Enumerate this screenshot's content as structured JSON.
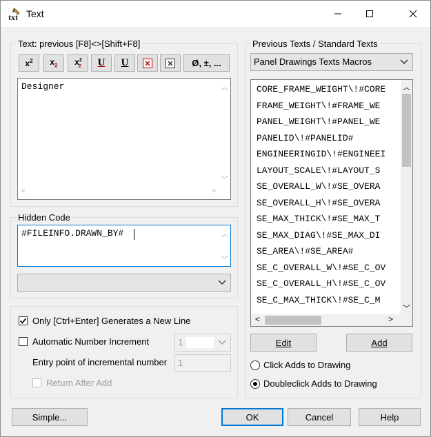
{
  "window": {
    "title": "Text"
  },
  "text_group": {
    "label": "Text: previous [F8]<>[Shift+F8]",
    "format_buttons": [
      {
        "name": "superscript-button",
        "base": "x",
        "sup": "2"
      },
      {
        "name": "subscript-button",
        "base": "x",
        "sub": "2"
      },
      {
        "name": "stacked-fraction-button",
        "base": "x",
        "sup": "2",
        "sub": "2"
      },
      {
        "name": "underline-button",
        "glyph": "U"
      },
      {
        "name": "overline-button",
        "glyph": "U"
      },
      {
        "name": "clear-format-button",
        "glyph": "×"
      },
      {
        "name": "delete-button",
        "glyph": "×"
      },
      {
        "name": "special-chars-button",
        "glyph": "Ø, ±, ..."
      }
    ],
    "text_value": "Designer"
  },
  "hidden_code": {
    "label": "Hidden Code",
    "value": "#FILEINFO.DRAWN_BY#",
    "dropdown_value": ""
  },
  "options": {
    "only_ctrl_enter": {
      "label_pre": "Only [Ctrl+Enter] Generates a New Line",
      "checked": true
    },
    "auto_number": {
      "label": "Automatic Number Increment",
      "value": "1",
      "checked": false
    },
    "entry_point": {
      "label": "Entry point of incremental number",
      "value": "1"
    },
    "return_after_add": {
      "label": "Return After Add",
      "checked": false
    }
  },
  "previous_texts": {
    "label": "Previous Texts / Standard Texts",
    "category": "Panel Drawings Texts Macros",
    "items": [
      "CORE_FRAME_WEIGHT\\!#CORE",
      "FRAME_WEIGHT\\!#FRAME_WE",
      "PANEL_WEIGHT\\!#PANEL_WE",
      "PANELID\\!#PANELID#",
      "ENGINEERINGID\\!#ENGINEEI",
      "LAYOUT_SCALE\\!#LAYOUT_S",
      "SE_OVERALL_W\\!#SE_OVERA",
      "SE_OVERALL_H\\!#SE_OVERA",
      "SE_MAX_THICK\\!#SE_MAX_T",
      "SE_MAX_DIAG\\!#SE_MAX_DI",
      "SE_AREA\\!#SE_AREA#",
      "SE_C_OVERALL_W\\!#SE_C_OV",
      "SE_C_OVERALL_H\\!#SE_C_OV",
      "SE_C_MAX_THICK\\!#SE_C_M"
    ],
    "edit_label": "Edit",
    "add_label": "Add",
    "click_adds": "Click Adds to Drawing",
    "doubleclick_adds": "Doubleclick Adds to Drawing",
    "selected_mode": "doubleclick"
  },
  "footer": {
    "simple_label": "Simple...",
    "ok_label": "OK",
    "cancel_label": "Cancel",
    "help_label": "Help"
  },
  "colors": {
    "accent": "#0078d7",
    "red_x": "#c00000"
  }
}
